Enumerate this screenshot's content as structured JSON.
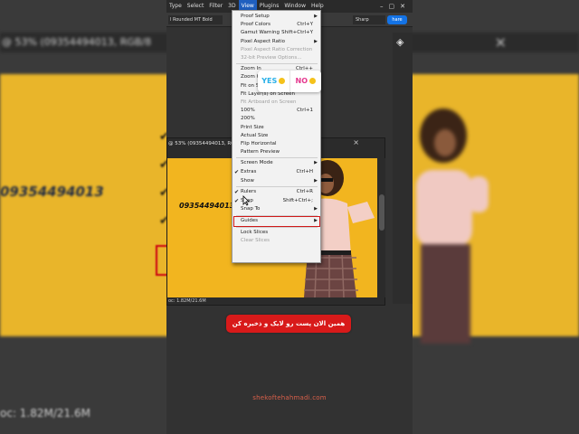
{
  "background": {
    "tab_title": "@ 53% (09354494013, RGB/8",
    "phone_text": "09354494013",
    "status_text": "oc: 1.82M/21.6M"
  },
  "menubar": {
    "items": [
      "Type",
      "Select",
      "Filter",
      "3D",
      "View",
      "Plugins",
      "Window",
      "Help"
    ],
    "active": "View"
  },
  "options_bar": {
    "font_value": "l Rounded MT Bold",
    "antialias_value": "Sharp",
    "share_label": "hare"
  },
  "document": {
    "title": "@ 53% (09354494013, RGB/8",
    "canvas_text": "09354494013",
    "status": "oc: 1.82M/21.6M"
  },
  "view_menu": {
    "items": [
      {
        "label": "Proof Setup",
        "shortcut": "",
        "submenu": true,
        "disabled": false,
        "checked": false
      },
      {
        "label": "Proof Colors",
        "shortcut": "Ctrl+Y",
        "submenu": false,
        "disabled": false,
        "checked": false
      },
      {
        "label": "Gamut Warning",
        "shortcut": "Shift+Ctrl+Y",
        "submenu": false,
        "disabled": false,
        "checked": false
      },
      {
        "label": "Pixel Aspect Ratio",
        "shortcut": "",
        "submenu": true,
        "disabled": false,
        "checked": false
      },
      {
        "label": "Pixel Aspect Ratio Correction",
        "shortcut": "",
        "submenu": false,
        "disabled": true,
        "checked": false
      },
      {
        "label": "32-bit Preview Options...",
        "shortcut": "",
        "submenu": false,
        "disabled": true,
        "checked": false
      },
      {
        "label": "Zoom In",
        "shortcut": "Ctrl++",
        "submenu": false,
        "disabled": false,
        "checked": false
      },
      {
        "label": "Zoom Out",
        "shortcut": "Ctrl+-",
        "submenu": false,
        "disabled": false,
        "checked": false
      },
      {
        "label": "Fit on Screen",
        "shortcut": "Ctrl+0",
        "submenu": false,
        "disabled": false,
        "checked": false
      },
      {
        "label": "Fit Layer(s) on Screen",
        "shortcut": "",
        "submenu": false,
        "disabled": false,
        "checked": false
      },
      {
        "label": "Fit Artboard on Screen",
        "shortcut": "",
        "submenu": false,
        "disabled": true,
        "checked": false
      },
      {
        "label": "100%",
        "shortcut": "Ctrl+1",
        "submenu": false,
        "disabled": false,
        "checked": false
      },
      {
        "label": "200%",
        "shortcut": "",
        "submenu": false,
        "disabled": false,
        "checked": false
      },
      {
        "label": "Print Size",
        "shortcut": "",
        "submenu": false,
        "disabled": false,
        "checked": false
      },
      {
        "label": "Actual Size",
        "shortcut": "",
        "submenu": false,
        "disabled": false,
        "checked": false
      },
      {
        "label": "Flip Horizontal",
        "shortcut": "",
        "submenu": false,
        "disabled": false,
        "checked": false
      },
      {
        "label": "Pattern Preview",
        "shortcut": "",
        "submenu": false,
        "disabled": false,
        "checked": false
      },
      {
        "label": "Screen Mode",
        "shortcut": "",
        "submenu": true,
        "disabled": false,
        "checked": false
      },
      {
        "label": "Extras",
        "shortcut": "Ctrl+H",
        "submenu": false,
        "disabled": false,
        "checked": true
      },
      {
        "label": "Show",
        "shortcut": "",
        "submenu": true,
        "disabled": false,
        "checked": false
      },
      {
        "label": "Rulers",
        "shortcut": "Ctrl+R",
        "submenu": false,
        "disabled": false,
        "checked": true
      },
      {
        "label": "Snap",
        "shortcut": "Shift+Ctrl+;",
        "submenu": false,
        "disabled": false,
        "checked": true
      },
      {
        "label": "Snap To",
        "shortcut": "",
        "submenu": true,
        "disabled": false,
        "checked": false
      },
      {
        "label": "Guides",
        "shortcut": "",
        "submenu": true,
        "disabled": false,
        "checked": false
      },
      {
        "label": "Lock Slices",
        "shortcut": "",
        "submenu": false,
        "disabled": false,
        "checked": false
      },
      {
        "label": "Clear Slices",
        "shortcut": "",
        "submenu": false,
        "disabled": true,
        "checked": false
      }
    ],
    "highlighted": "Guides"
  },
  "poll": {
    "yes_label": "YES",
    "no_label": "NO"
  },
  "banner": {
    "text": "همین الان پست رو لایک و ذخیره کن"
  },
  "watermark": {
    "text": "shekoftehahmadi.com"
  },
  "colors": {
    "banner_red": "#d81a1a",
    "photo_yellow": "#f2b51f",
    "guides_highlight": "#d01818",
    "menubar_active": "#1f5fbf",
    "share_blue": "#1473e6",
    "poll_yes": "#29b0e8",
    "poll_no": "#e5388f"
  }
}
